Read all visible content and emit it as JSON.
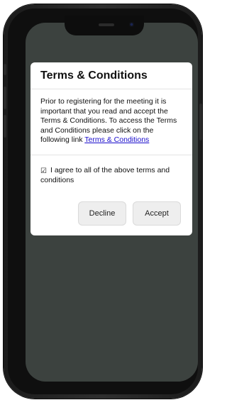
{
  "modal": {
    "title": "Terms & Conditions",
    "body_text": "Prior to registering for the meeting it is important that you read and accept the Terms & Conditions. To access the Terms and Conditions please click on the following link ",
    "link_text": "Terms & Conditions",
    "agree_checkbox_glyph": "☑",
    "agree_text": "I agree to all of the above terms and conditions",
    "decline_label": "Decline",
    "accept_label": "Accept"
  },
  "colors": {
    "screen_background": "#3c423f",
    "link": "#1a0dcc"
  }
}
